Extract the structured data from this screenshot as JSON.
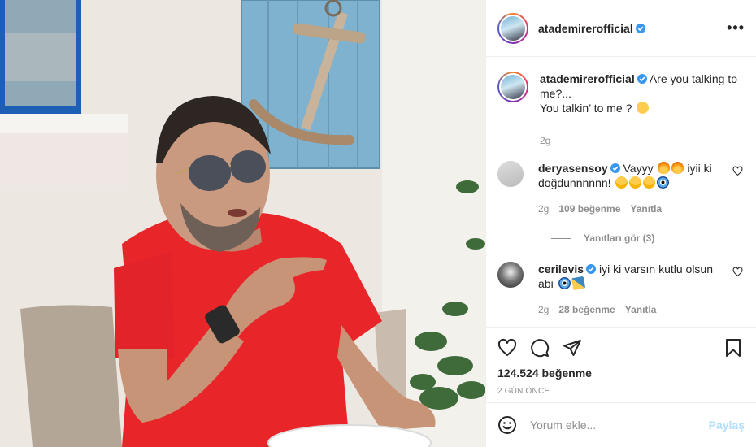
{
  "post": {
    "photo_alt": "Photo of a man in a red t-shirt and aviator sunglasses pointing, sitting at a table next to a white wall with a wooden anchor sign",
    "author": "atademirerofficial",
    "more_label": "•••"
  },
  "caption": {
    "username": "atademirerofficial",
    "line1": "Are you talking to me?...",
    "line2": "You talkin’ to me ?",
    "time": "2g"
  },
  "comments": [
    {
      "username": "deryasensoy",
      "text_a": "Vayyy",
      "text_b": "iyii ki doğdunnnnnn!",
      "time": "2g",
      "likes": "109 beğenme",
      "reply": "Yanıtla"
    },
    {
      "username": "cerilevis",
      "text_a": "iyi ki varsın kutlu olsun abi",
      "time": "2g",
      "likes": "28 beğenme",
      "reply": "Yanıtla"
    }
  ],
  "view_replies": "Yanıtları gör (3)",
  "likes_count": "124.524 beğenme",
  "date_label": "2 gün önce",
  "composer": {
    "placeholder": "Yorum ekle...",
    "post_label": "Paylaş"
  },
  "colors": {
    "verified": "#3897f0",
    "link_disabled": "#b2dffc",
    "shirt": "#e8262a",
    "wood": "#7fb2cf"
  }
}
